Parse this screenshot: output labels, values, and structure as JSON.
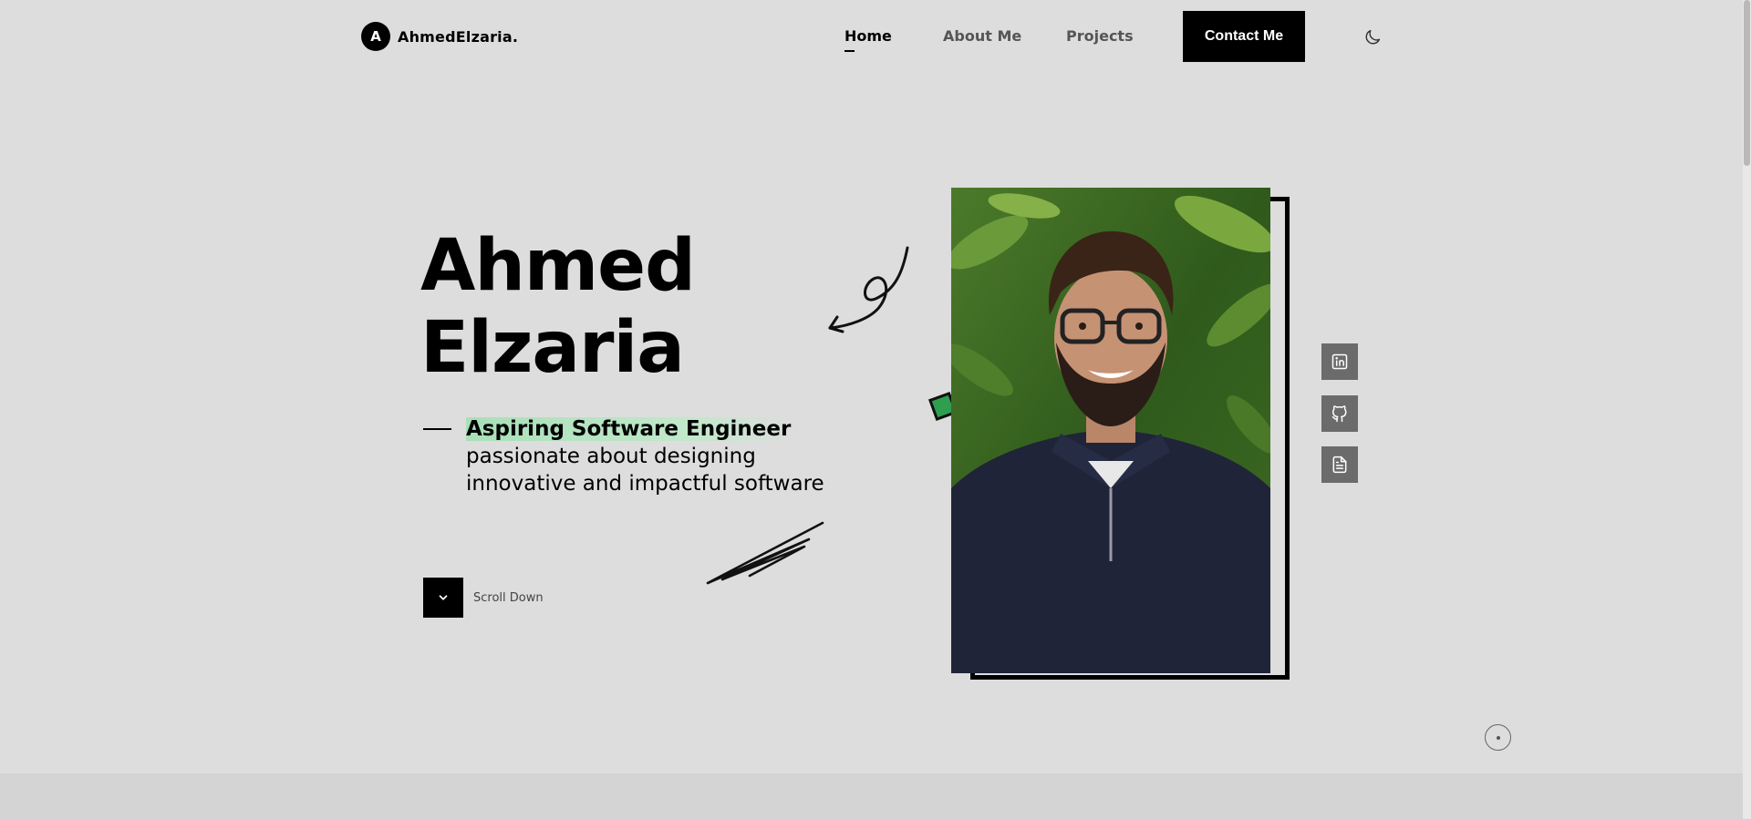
{
  "brand": {
    "logo_letter": "A",
    "name": "AhmedElzaria."
  },
  "nav": {
    "items": [
      {
        "label": "Home",
        "active": true
      },
      {
        "label": "About Me",
        "active": false
      },
      {
        "label": "Projects",
        "active": false
      }
    ],
    "contact_label": "Contact Me",
    "theme_icon": "moon-icon"
  },
  "hero": {
    "first_name": "Ahmed",
    "last_name": "Elzaria",
    "highlight": "Aspiring Software Engineer",
    "tagline_line1": "passionate about designing",
    "tagline_line2": "innovative and impactful software",
    "scroll_label": "Scroll Down"
  },
  "social": {
    "items": [
      "linkedin-icon",
      "github-icon",
      "resume-icon"
    ]
  },
  "colors": {
    "background": "#dddddd",
    "accent_green": "#2e9e4f",
    "highlight_green": "#a8e0b8",
    "social_button": "#6b6b6b"
  }
}
